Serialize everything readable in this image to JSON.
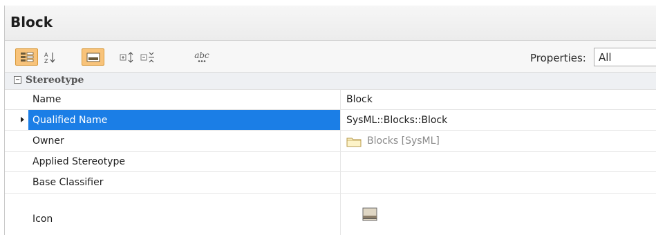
{
  "panel": {
    "title": "Block"
  },
  "toolbar": {
    "properties_label": "Properties:",
    "properties_value": "All",
    "abc_label": "abc"
  },
  "grid": {
    "category": "Stereotype",
    "rows": [
      {
        "name": "Name",
        "value": "Block"
      },
      {
        "name": "Qualified Name",
        "value": "SysML::Blocks::Block"
      },
      {
        "name": "Owner",
        "value": "Blocks [SysML]"
      },
      {
        "name": "Applied Stereotype",
        "value": ""
      },
      {
        "name": "Base Classifier",
        "value": ""
      },
      {
        "name": "Icon",
        "value": ""
      }
    ]
  },
  "icons": {
    "group-by-category": "group-by-category-icon",
    "sort-alphabetical": "sort-az-icon",
    "show-description": "description-panel-icon",
    "expand-all": "expand-all-icon",
    "collapse-all": "collapse-all-icon",
    "abc": "abc-options-icon",
    "folder": "folder-icon",
    "stereotype-icon": "image-icon"
  },
  "colors": {
    "selection": "#1b7ee6",
    "active_button": "#f8c37a"
  }
}
